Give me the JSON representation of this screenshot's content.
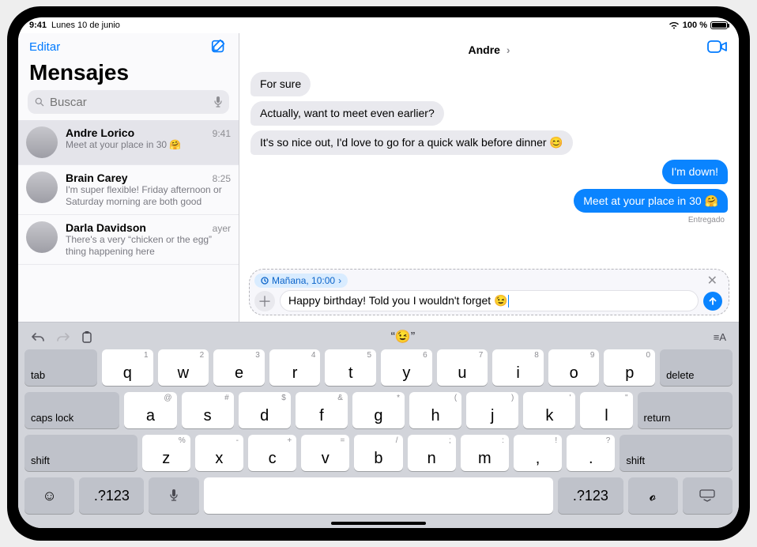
{
  "status": {
    "time": "9:41",
    "date": "Lunes 10 de junio",
    "battery_pct": "100 %"
  },
  "sidebar": {
    "edit": "Editar",
    "title": "Mensajes",
    "search_placeholder": "Buscar",
    "conversations": [
      {
        "name": "Andre Lorico",
        "time": "9:41",
        "snippet": "Meet at your place in 30 🤗"
      },
      {
        "name": "Brain Carey",
        "time": "8:25",
        "snippet": "I'm super flexible! Friday afternoon or Saturday morning are both good"
      },
      {
        "name": "Darla Davidson",
        "time": "ayer",
        "snippet": "There's a very “chicken or the egg” thing happening here"
      }
    ]
  },
  "chat": {
    "title": "Andre",
    "messages": [
      {
        "dir": "in",
        "text": "For sure"
      },
      {
        "dir": "in",
        "text": "Actually, want to meet even earlier?"
      },
      {
        "dir": "in",
        "text": "It's so nice out, I'd love to go for a quick walk before dinner 😊"
      },
      {
        "dir": "out",
        "text": "I'm down!"
      },
      {
        "dir": "out",
        "text": "Meet at your place in 30 🤗"
      }
    ],
    "delivery": "Entregado",
    "schedule_label": "Mañana, 10:00",
    "draft": "Happy birthday! Told you I wouldn't forget 😉"
  },
  "keyboard": {
    "suggestion_emoji": "“😉”",
    "row1": [
      {
        "l": "q",
        "s": "1"
      },
      {
        "l": "w",
        "s": "2"
      },
      {
        "l": "e",
        "s": "3"
      },
      {
        "l": "r",
        "s": "4"
      },
      {
        "l": "t",
        "s": "5"
      },
      {
        "l": "y",
        "s": "6"
      },
      {
        "l": "u",
        "s": "7"
      },
      {
        "l": "i",
        "s": "8"
      },
      {
        "l": "o",
        "s": "9"
      },
      {
        "l": "p",
        "s": "0"
      }
    ],
    "row2": [
      {
        "l": "a",
        "s": "@"
      },
      {
        "l": "s",
        "s": "#"
      },
      {
        "l": "d",
        "s": "$"
      },
      {
        "l": "f",
        "s": "&"
      },
      {
        "l": "g",
        "s": "*"
      },
      {
        "l": "h",
        "s": "("
      },
      {
        "l": "j",
        "s": ")"
      },
      {
        "l": "k",
        "s": "'"
      },
      {
        "l": "l",
        "s": "\""
      }
    ],
    "row3": [
      {
        "l": "z",
        "s": "%"
      },
      {
        "l": "x",
        "s": "-"
      },
      {
        "l": "c",
        "s": "+"
      },
      {
        "l": "v",
        "s": "="
      },
      {
        "l": "b",
        "s": "/"
      },
      {
        "l": "n",
        "s": ";"
      },
      {
        "l": "m",
        "s": ":"
      },
      {
        "l": ",",
        "s": "!"
      },
      {
        "l": ".",
        "s": "?"
      }
    ],
    "tab": "tab",
    "delete": "delete",
    "caps": "caps lock",
    "return": "return",
    "shift": "shift",
    "numsym": ".?123"
  }
}
